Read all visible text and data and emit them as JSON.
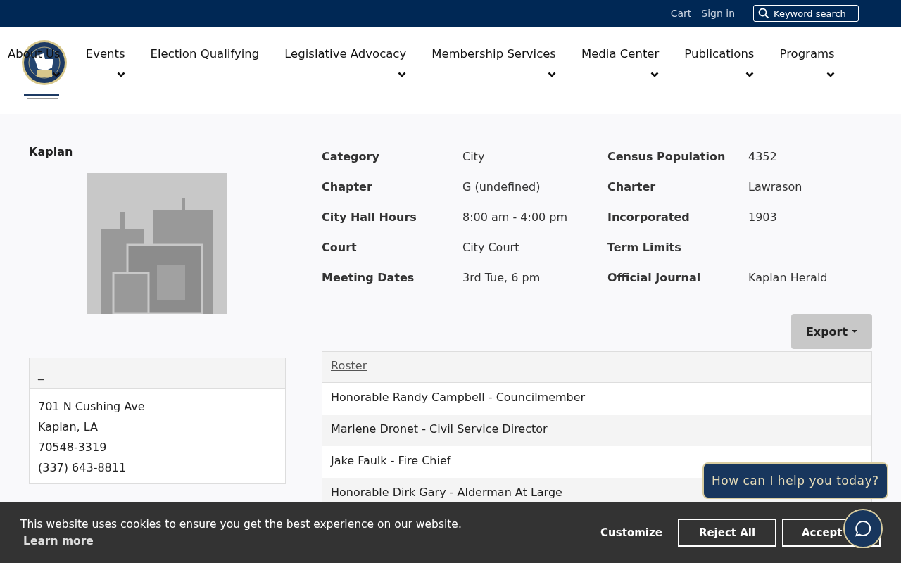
{
  "top_bar": {
    "links": [
      "Cart",
      "Sign in"
    ],
    "search": {
      "placeholder": "Keyword search"
    }
  },
  "nav": [
    {
      "label": "About Us",
      "has_dropdown": true
    },
    {
      "label": "Events",
      "has_dropdown": true
    },
    {
      "label": "Election Qualifying",
      "has_dropdown": false
    },
    {
      "label": "Legislative Advocacy",
      "has_dropdown": true
    },
    {
      "label": "Membership Services",
      "has_dropdown": true
    },
    {
      "label": "Media Center",
      "has_dropdown": true
    },
    {
      "label": "Publications",
      "has_dropdown": true
    },
    {
      "label": "Programs",
      "has_dropdown": true
    }
  ],
  "profile": {
    "name": "Kaplan"
  },
  "details": [
    {
      "label": "Category",
      "value": "City"
    },
    {
      "label": "Census Population",
      "value": "4352"
    },
    {
      "label": "Chapter",
      "value": "G (undefined)"
    },
    {
      "label": "Charter",
      "value": "Lawrason"
    },
    {
      "label": "City Hall Hours",
      "value": "8:00 am - 4:00 pm"
    },
    {
      "label": "Incorporated",
      "value": "1903"
    },
    {
      "label": "Court",
      "value": "City Court"
    },
    {
      "label": "Term Limits"
    },
    {
      "label": "Meeting Dates",
      "value": "3rd Tue, 6 pm"
    },
    {
      "label": "Official Journal",
      "value": "Kaplan Herald"
    }
  ],
  "export_button": "Export",
  "address_card": {
    "heading": "_",
    "lines": [
      "701 N Cushing Ave",
      "Kaplan, LA",
      "70548-3319",
      "(337) 643-8811"
    ]
  },
  "roster": {
    "heading": "Roster",
    "rows": [
      "Honorable Randy Campbell - Councilmember",
      "Marlene Dronet - Civil Service Director",
      "Jake Faulk - Fire Chief",
      "Honorable Dirk Gary - Alderman At Large"
    ]
  },
  "cookie_banner": {
    "message": "This website uses cookies to ensure you get the best experience on our website.",
    "learn_more": "Learn more",
    "buttons": [
      "Customize",
      "Reject All",
      "Accept"
    ]
  },
  "chat": {
    "prompt": "How can I help you today?"
  }
}
